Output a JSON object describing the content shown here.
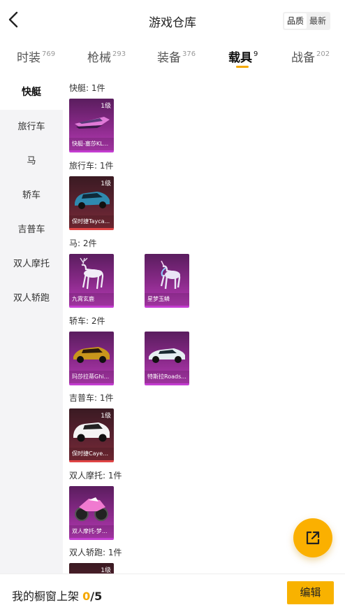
{
  "header": {
    "title": "游戏仓库",
    "sort": [
      "品质",
      "最新"
    ]
  },
  "tabs": [
    {
      "label": "时装",
      "count": "769"
    },
    {
      "label": "枪械",
      "count": "293"
    },
    {
      "label": "装备",
      "count": "376"
    },
    {
      "label": "载具",
      "count": "9"
    },
    {
      "label": "战备",
      "count": "202"
    }
  ],
  "sidebar": {
    "items": [
      "快艇",
      "旅行车",
      "马",
      "轿车",
      "吉普车",
      "双人摩托",
      "双人轿跑"
    ]
  },
  "sections": [
    {
      "title": "快艇: 1件",
      "cards": [
        {
          "name": "快艇-塞莎KL...",
          "level": "1级"
        }
      ]
    },
    {
      "title": "旅行车: 1件",
      "cards": [
        {
          "name": "保时捷Tayca...",
          "level": "1级"
        }
      ]
    },
    {
      "title": "马: 2件",
      "cards": [
        {
          "name": "九霄玄鹿"
        },
        {
          "name": "星梦玉鳞"
        }
      ]
    },
    {
      "title": "轿车: 2件",
      "cards": [
        {
          "name": "玛莎拉蒂Ghi..."
        },
        {
          "name": "特斯拉Roads..."
        }
      ]
    },
    {
      "title": "吉普车: 1件",
      "cards": [
        {
          "name": "保时捷Cayen...",
          "level": "1级"
        }
      ]
    },
    {
      "title": "双人摩托: 1件",
      "cards": [
        {
          "name": "双人摩托-梦..."
        }
      ]
    },
    {
      "title": "双人轿跑: 1件",
      "cards": [
        {
          "level": "1级"
        }
      ]
    }
  ],
  "footer": {
    "label": "我的橱窗上架",
    "count": "0",
    "total": "/5",
    "edit": "编辑"
  },
  "colors": {
    "accent": "#f8b200",
    "purple_rarity": "#c33dd0",
    "red_rarity": "#e04545"
  }
}
